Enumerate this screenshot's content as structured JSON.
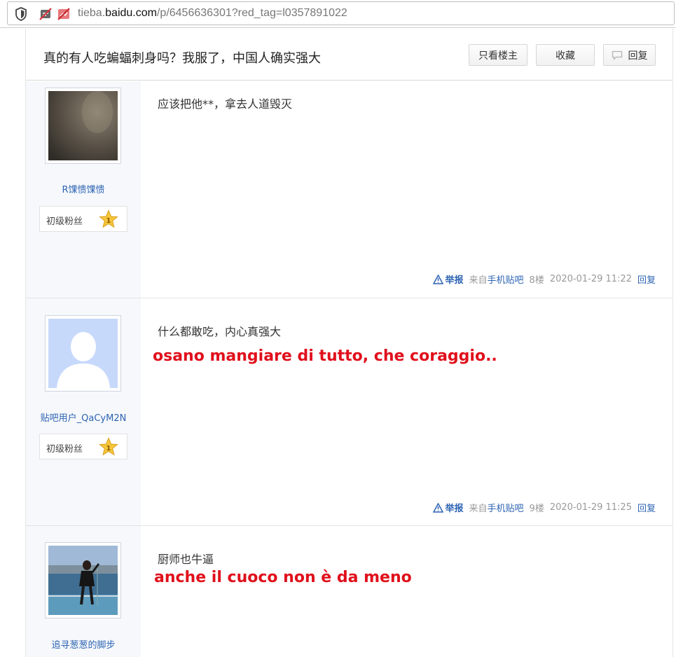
{
  "browser": {
    "url_prefix": "tieba.",
    "url_domain": "baidu.com",
    "url_path": "/p/6456636301?red_tag=l0357891022"
  },
  "thread": {
    "title": "真的有人吃蝙蝠刺身吗？我服了，中国人确实强大",
    "btn_only_op": "只看楼主",
    "btn_favorite": "收藏",
    "btn_reply": "回复"
  },
  "posts": [
    {
      "username": "R馃愦馃愦",
      "badge": "初级粉丝",
      "level": "1",
      "content": "应该把他**，拿去人道毁灭",
      "report": "举报",
      "source_prefix": "来自",
      "source_link": "手机贴吧",
      "floor": "8楼",
      "time": "2020-01-29 11:22",
      "reply": "回复"
    },
    {
      "username": "贴吧用户_QaCyM2N",
      "badge": "初级粉丝",
      "level": "1",
      "content": "什么都敢吃，内心真强大",
      "overlay": "osano mangiare di tutto, che coraggio..",
      "report": "举报",
      "source_prefix": "来自",
      "source_link": "手机贴吧",
      "floor": "9楼",
      "time": "2020-01-29 11:25",
      "reply": "回复"
    },
    {
      "username": "追寻葱葱的脚步",
      "content": "厨师也牛逼",
      "overlay": "anche il cuoco non è da meno"
    }
  ],
  "colors": {
    "link": "#2d64b3",
    "overlay_red": "#e0101c",
    "sidebar": "#f6f8fb"
  }
}
